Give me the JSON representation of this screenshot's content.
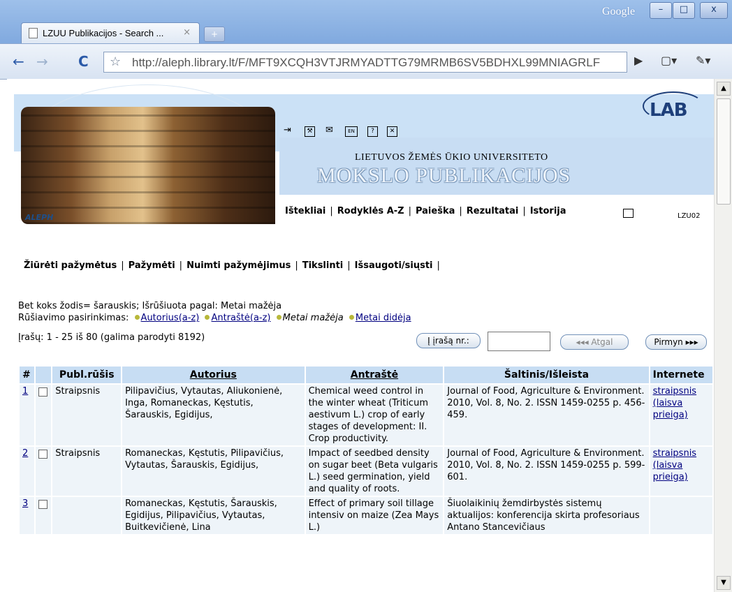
{
  "browser": {
    "tab_title": "LZUU Publikacijos - Search ...",
    "tab_close": "×",
    "new_tab": "+",
    "url": "http://aleph.library.lt/F/MFT9XCQH3VTJRMYADTTG79MRMB6SV5BDHXL99MNIAGRLF",
    "google_label": "Google",
    "win_min": "–",
    "win_max": "□",
    "win_close": "x",
    "back": "←",
    "forward": "→",
    "reload": "C",
    "star": "☆",
    "go": "▶",
    "page_menu": "▢▾",
    "tools_menu": "✎▾"
  },
  "header": {
    "aleph_label": "ALEPH",
    "lab_logo": "LAB",
    "university": "LIETUVOS ŽEMĖS ŪKIO UNIVERSITETO",
    "title": "MOKSLO PUBLIKACIJOS",
    "icons": {
      "login": "⇥",
      "prefs": "⚒",
      "mail": "✉",
      "lang": "EN",
      "help": "?",
      "close": "✕"
    },
    "nav": [
      "Ištekliai",
      "Rodyklės A-Z",
      "Paieška",
      "Rezultatai",
      "Istorija"
    ],
    "base_code": "LZU02"
  },
  "actions": [
    "Žiūrėti pažymėtus",
    "Pažymėti",
    "Nuimti pažymėjimus",
    "Tikslinti",
    "Išsaugoti/siųsti"
  ],
  "query": {
    "text": "Bet koks žodis= šarauskis; Išrūšiuota pagal: Metai mažėja",
    "sort_label": "Rūšiavimo pasirinkimas:",
    "sort_options": [
      "Autorius(a-z)",
      "Antraštė(a-z)",
      "Metai mažėja",
      "Metai didėja"
    ],
    "count": "Įrašų: 1 - 25 iš 80 (galima parodyti 8192)",
    "jump_label": "Į įrašą nr.:",
    "jump_value": "",
    "prev_label": "◂◂◂ Atgal",
    "next_label": "Pirmyn ▸▸▸"
  },
  "table": {
    "headers": [
      "#",
      "",
      "Publ.rūšis",
      "Autorius",
      "Antraštė",
      "Šaltinis/Išleista",
      "Internete"
    ],
    "rows": [
      {
        "num": "1",
        "type": "Straipsnis",
        "author": "Pilipavičius, Vytautas, Aliukonienė, Inga, Romaneckas, Kęstutis, Šarauskis, Egidijus,",
        "title": "Chemical weed control in the winter wheat (Triticum aestivum L.) crop of early stages of development: II. Crop productivity.",
        "source": "Journal of Food, Agriculture & Environment. 2010, Vol. 8, No. 2. ISSN 1459-0255 p. 456-459.",
        "online": "straipsnis (laisva prieiga)"
      },
      {
        "num": "2",
        "type": "Straipsnis",
        "author": "Romaneckas, Kęstutis, Pilipavičius, Vytautas, Šarauskis, Egidijus,",
        "title": "Impact of seedbed density on sugar beet (Beta vulgaris L.) seed germination, yield and quality of roots.",
        "source": "Journal of Food, Agriculture & Environment. 2010, Vol. 8, No. 2. ISSN 1459-0255 p. 599-601.",
        "online": "straipsnis (laisva prieiga)"
      },
      {
        "num": "3",
        "type": "",
        "author": "Romaneckas, Kęstutis, Šarauskis, Egidijus, Pilipavičius, Vytautas, Buitkevičienė, Lina",
        "title": "Effect of primary soil tillage intensiv on maize (Zea Mays L.)",
        "source": "Šiuolaikinių žemdirbystės sistemų aktualijos: konferencija skirta profesoriaus Antano Stancevičiaus",
        "online": ""
      }
    ]
  }
}
